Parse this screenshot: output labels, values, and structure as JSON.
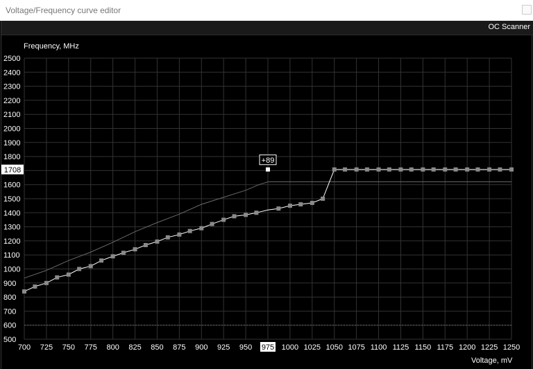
{
  "window": {
    "title": "Voltage/Frequency curve editor"
  },
  "toolbar": {
    "oc_scanner_label": "OC Scanner"
  },
  "axes": {
    "y_label": "Frequency, MHz",
    "x_label": "Voltage, mV",
    "y_ticks": [
      2500,
      2400,
      2300,
      2200,
      2100,
      2000,
      1900,
      1800,
      1700,
      1600,
      1500,
      1400,
      1300,
      1200,
      1100,
      1000,
      900,
      800,
      700,
      600,
      500
    ],
    "x_ticks": [
      700,
      725,
      750,
      775,
      800,
      825,
      850,
      875,
      900,
      925,
      950,
      975,
      1000,
      1025,
      1050,
      1075,
      1100,
      1125,
      1150,
      1175,
      1200,
      1225,
      1250
    ]
  },
  "selection": {
    "voltage": "975",
    "frequency": "1708",
    "offset": "+89"
  },
  "reference": {
    "dashed_frequency": 600
  },
  "chart_data": {
    "type": "line",
    "title": "",
    "xlabel": "Voltage, mV",
    "ylabel": "Frequency, MHz",
    "xlim": [
      700,
      1250
    ],
    "ylim": [
      500,
      2500
    ],
    "series": [
      {
        "name": "",
        "color": "#cfcfcf",
        "x": [
          700,
          712,
          725,
          737,
          750,
          762,
          775,
          787,
          800,
          812,
          825,
          837,
          850,
          862,
          875,
          887,
          900,
          912,
          925,
          937,
          950,
          962,
          975,
          987,
          1000,
          1012,
          1025,
          1037,
          1050,
          1062,
          1075,
          1087,
          1100,
          1112,
          1125,
          1137,
          1150,
          1162,
          1175,
          1187,
          1200,
          1212,
          1225,
          1237,
          1250
        ],
        "y": [
          840,
          875,
          900,
          940,
          960,
          1000,
          1020,
          1060,
          1090,
          1115,
          1140,
          1170,
          1195,
          1225,
          1245,
          1270,
          1290,
          1320,
          1350,
          1375,
          1385,
          1400,
          1420,
          1430,
          1450,
          1460,
          1470,
          1500,
          1708,
          1708,
          1708,
          1708,
          1708,
          1708,
          1708,
          1708,
          1708,
          1708,
          1708,
          1708,
          1708,
          1708,
          1708,
          1708,
          1708
        ]
      },
      {
        "name": "",
        "color": "#6a6a6a",
        "x": [
          700,
          725,
          750,
          775,
          800,
          825,
          850,
          875,
          900,
          925,
          950,
          965,
          975,
          1250
        ],
        "y": [
          935,
          990,
          1060,
          1120,
          1190,
          1265,
          1330,
          1390,
          1460,
          1510,
          1560,
          1600,
          1620,
          1620
        ]
      }
    ]
  }
}
